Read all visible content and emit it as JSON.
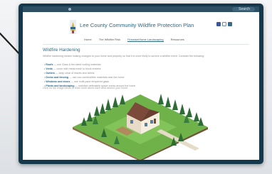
{
  "site": {
    "title": "Lee County Community Wildfire Protection Plan",
    "search_label": "Search"
  },
  "nav": {
    "items": [
      "Home",
      "The Wildfire Risk",
      "Firewise/Home Landscaping",
      "Resources"
    ],
    "active_index": 2
  },
  "content": {
    "section_title": "Wildfire Hardening",
    "intro": "Wildfire hardening means making changes to your home and property so that it is more likely to survive a wildfire event. Consider the following:",
    "bullets": [
      {
        "term": "Roofs",
        "text": " — use Class A fire-rated roofing materials"
      },
      {
        "term": "Vents",
        "text": " — cover with metal mesh to block embers"
      },
      {
        "term": "Gutters",
        "text": " — keep clear of leaves and debris"
      },
      {
        "term": "Decks and fencing",
        "text": " — use non-combustible materials near the home"
      },
      {
        "term": "Windows and doors",
        "text": " — use multi-pane tempered glass"
      },
      {
        "term": "Plants and landscaping",
        "text": " — maintain defensible space zones around the home"
      }
    ],
    "footnote": "Click on the image below to learn more about each area around your home."
  },
  "colors": {
    "monitor_bezel": "#16384d",
    "header_bar": "#2e4e64",
    "accent": "#2d6a8a",
    "lawn": "#6fb24a",
    "trees": "#2f6b34",
    "ground": "#8a6b45"
  },
  "icons": {
    "social": [
      "facebook-icon",
      "share-icon",
      "feed-icon"
    ],
    "logo": "county-logo-icon"
  }
}
